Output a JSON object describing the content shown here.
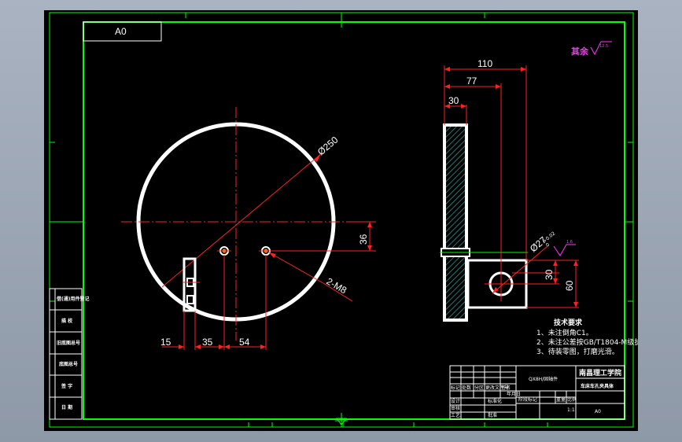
{
  "sheet_label": "A0",
  "roughness_label": "其余",
  "roughness_value": "12.5",
  "dimensions": {
    "d250": "Ø250",
    "d36": "36",
    "m8": "2-M8",
    "d15": "15",
    "d35": "35",
    "d54": "54",
    "d110": "110",
    "d77": "77",
    "d30a": "30",
    "d27": "Ø27",
    "tol_upper": "+0.02",
    "tol_lower": "0",
    "d30b": "30",
    "d60": "60",
    "rough_small": "1.6"
  },
  "tech_notes": {
    "title": "技术要求",
    "lines": [
      "1、未注倒角C1。",
      "2、未注公差按GB/T1804-M级执行。",
      "3、待装零图，打磨光滑。"
    ]
  },
  "left_table": [
    "借(通)用件登记",
    "描 校",
    "旧底图总号",
    "底图总号",
    "签 字",
    "日 期"
  ],
  "title_block": {
    "part_code": "QX8H/固轴件",
    "school": "南昌理工学院",
    "part_name": "车床车孔夹具体",
    "sheet_size": "A0",
    "mini_headers": [
      "标记",
      "处数",
      "分区",
      "更改文件号",
      "签名",
      "年月日"
    ],
    "labels": [
      "设计",
      "标准化",
      "审核",
      "工艺",
      "批准",
      "阶段标记",
      "重量",
      "比例"
    ],
    "scale": "1:1"
  }
}
